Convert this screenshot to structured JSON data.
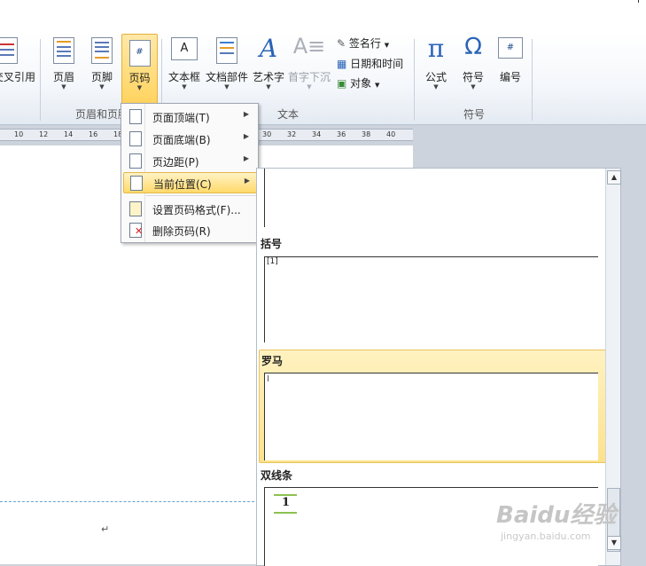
{
  "ribbon": {
    "buttons": {
      "cross_ref": "交叉引用",
      "header": "页眉",
      "footer": "页脚",
      "page_number": "页码",
      "text_box": "文本框",
      "quick_parts": "文档部件",
      "wordart": "艺术字",
      "drop_cap": "首字下沉",
      "signature_line": "签名行",
      "date_time": "日期和时间",
      "object": "对象",
      "equation": "公式",
      "symbol": "符号",
      "number": "编号"
    },
    "groups": {
      "header_footer": "页眉和页脚",
      "text": "文本",
      "symbols": "符号"
    }
  },
  "ruler": {
    "ticks": [
      "10",
      "12",
      "14",
      "16",
      "18",
      "30",
      "32",
      "34",
      "36",
      "38",
      "40"
    ]
  },
  "menu": {
    "items": [
      {
        "label": "页面顶端(T)",
        "has_submenu": true
      },
      {
        "label": "页面底端(B)",
        "has_submenu": true
      },
      {
        "label": "页边距(P)",
        "has_submenu": true
      },
      {
        "label": "当前位置(C)",
        "has_submenu": true,
        "highlighted": true
      },
      {
        "label": "设置页码格式(F)...",
        "has_submenu": false
      },
      {
        "label": "删除页码(R)",
        "has_submenu": false
      }
    ]
  },
  "gallery": {
    "items": [
      {
        "label": "括号",
        "preview": "[1]"
      },
      {
        "label": "罗马",
        "preview": "I",
        "selected": true
      },
      {
        "label": "双线条",
        "preview": "1"
      }
    ]
  },
  "watermark": {
    "brand": "Baidu经验",
    "url": "jingyan.baidu.com"
  },
  "colors": {
    "highlight": "#ffd96b",
    "dashed_line": "#6aa2cf"
  }
}
